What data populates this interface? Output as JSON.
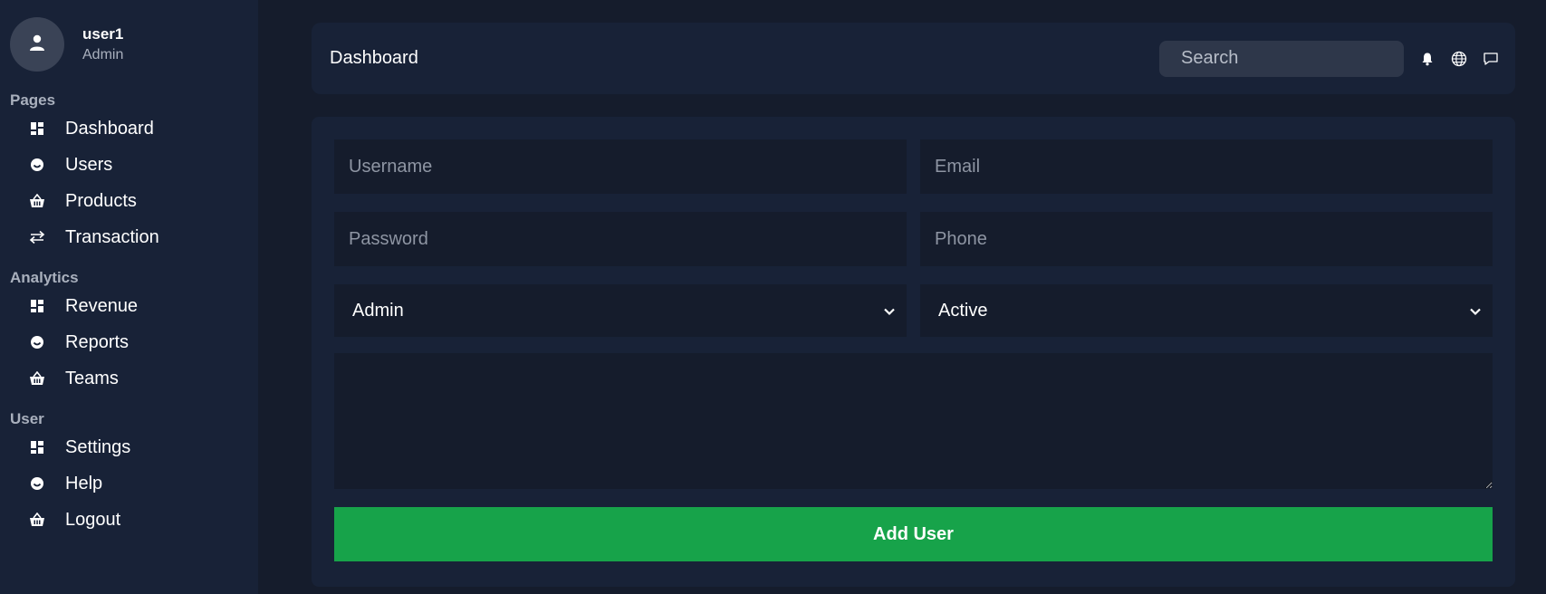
{
  "colors": {
    "background": "#151c2c",
    "sidebar": "#182237",
    "card": "#182237",
    "input": "#151c2c",
    "search": "#2e374a",
    "accent_green": "#17a34a",
    "muted_text": "#a9b0bd"
  },
  "user": {
    "name": "user1",
    "role": "Admin",
    "avatar_icon": "user-icon"
  },
  "sidebar": {
    "sections": [
      {
        "title": "Pages",
        "items": [
          {
            "label": "Dashboard",
            "icon": "dashboard-icon"
          },
          {
            "label": "Users",
            "icon": "smile-icon"
          },
          {
            "label": "Products",
            "icon": "basket-icon"
          },
          {
            "label": "Transaction",
            "icon": "arrows-exchange-icon"
          }
        ]
      },
      {
        "title": "Analytics",
        "items": [
          {
            "label": "Revenue",
            "icon": "dashboard-icon"
          },
          {
            "label": "Reports",
            "icon": "smile-icon"
          },
          {
            "label": "Teams",
            "icon": "basket-icon"
          }
        ]
      },
      {
        "title": "User",
        "items": [
          {
            "label": "Settings",
            "icon": "dashboard-icon"
          },
          {
            "label": "Help",
            "icon": "smile-icon"
          },
          {
            "label": "Logout",
            "icon": "basket-icon"
          }
        ]
      }
    ]
  },
  "topbar": {
    "title": "Dashboard",
    "search_placeholder": "Search",
    "icons": [
      "bell-icon",
      "globe-icon",
      "message-icon"
    ]
  },
  "form": {
    "username_placeholder": "Username",
    "email_placeholder": "Email",
    "password_placeholder": "Password",
    "phone_placeholder": "Phone",
    "role_select_value": "Admin",
    "status_select_value": "Active",
    "description_value": "",
    "submit_label": "Add User"
  }
}
